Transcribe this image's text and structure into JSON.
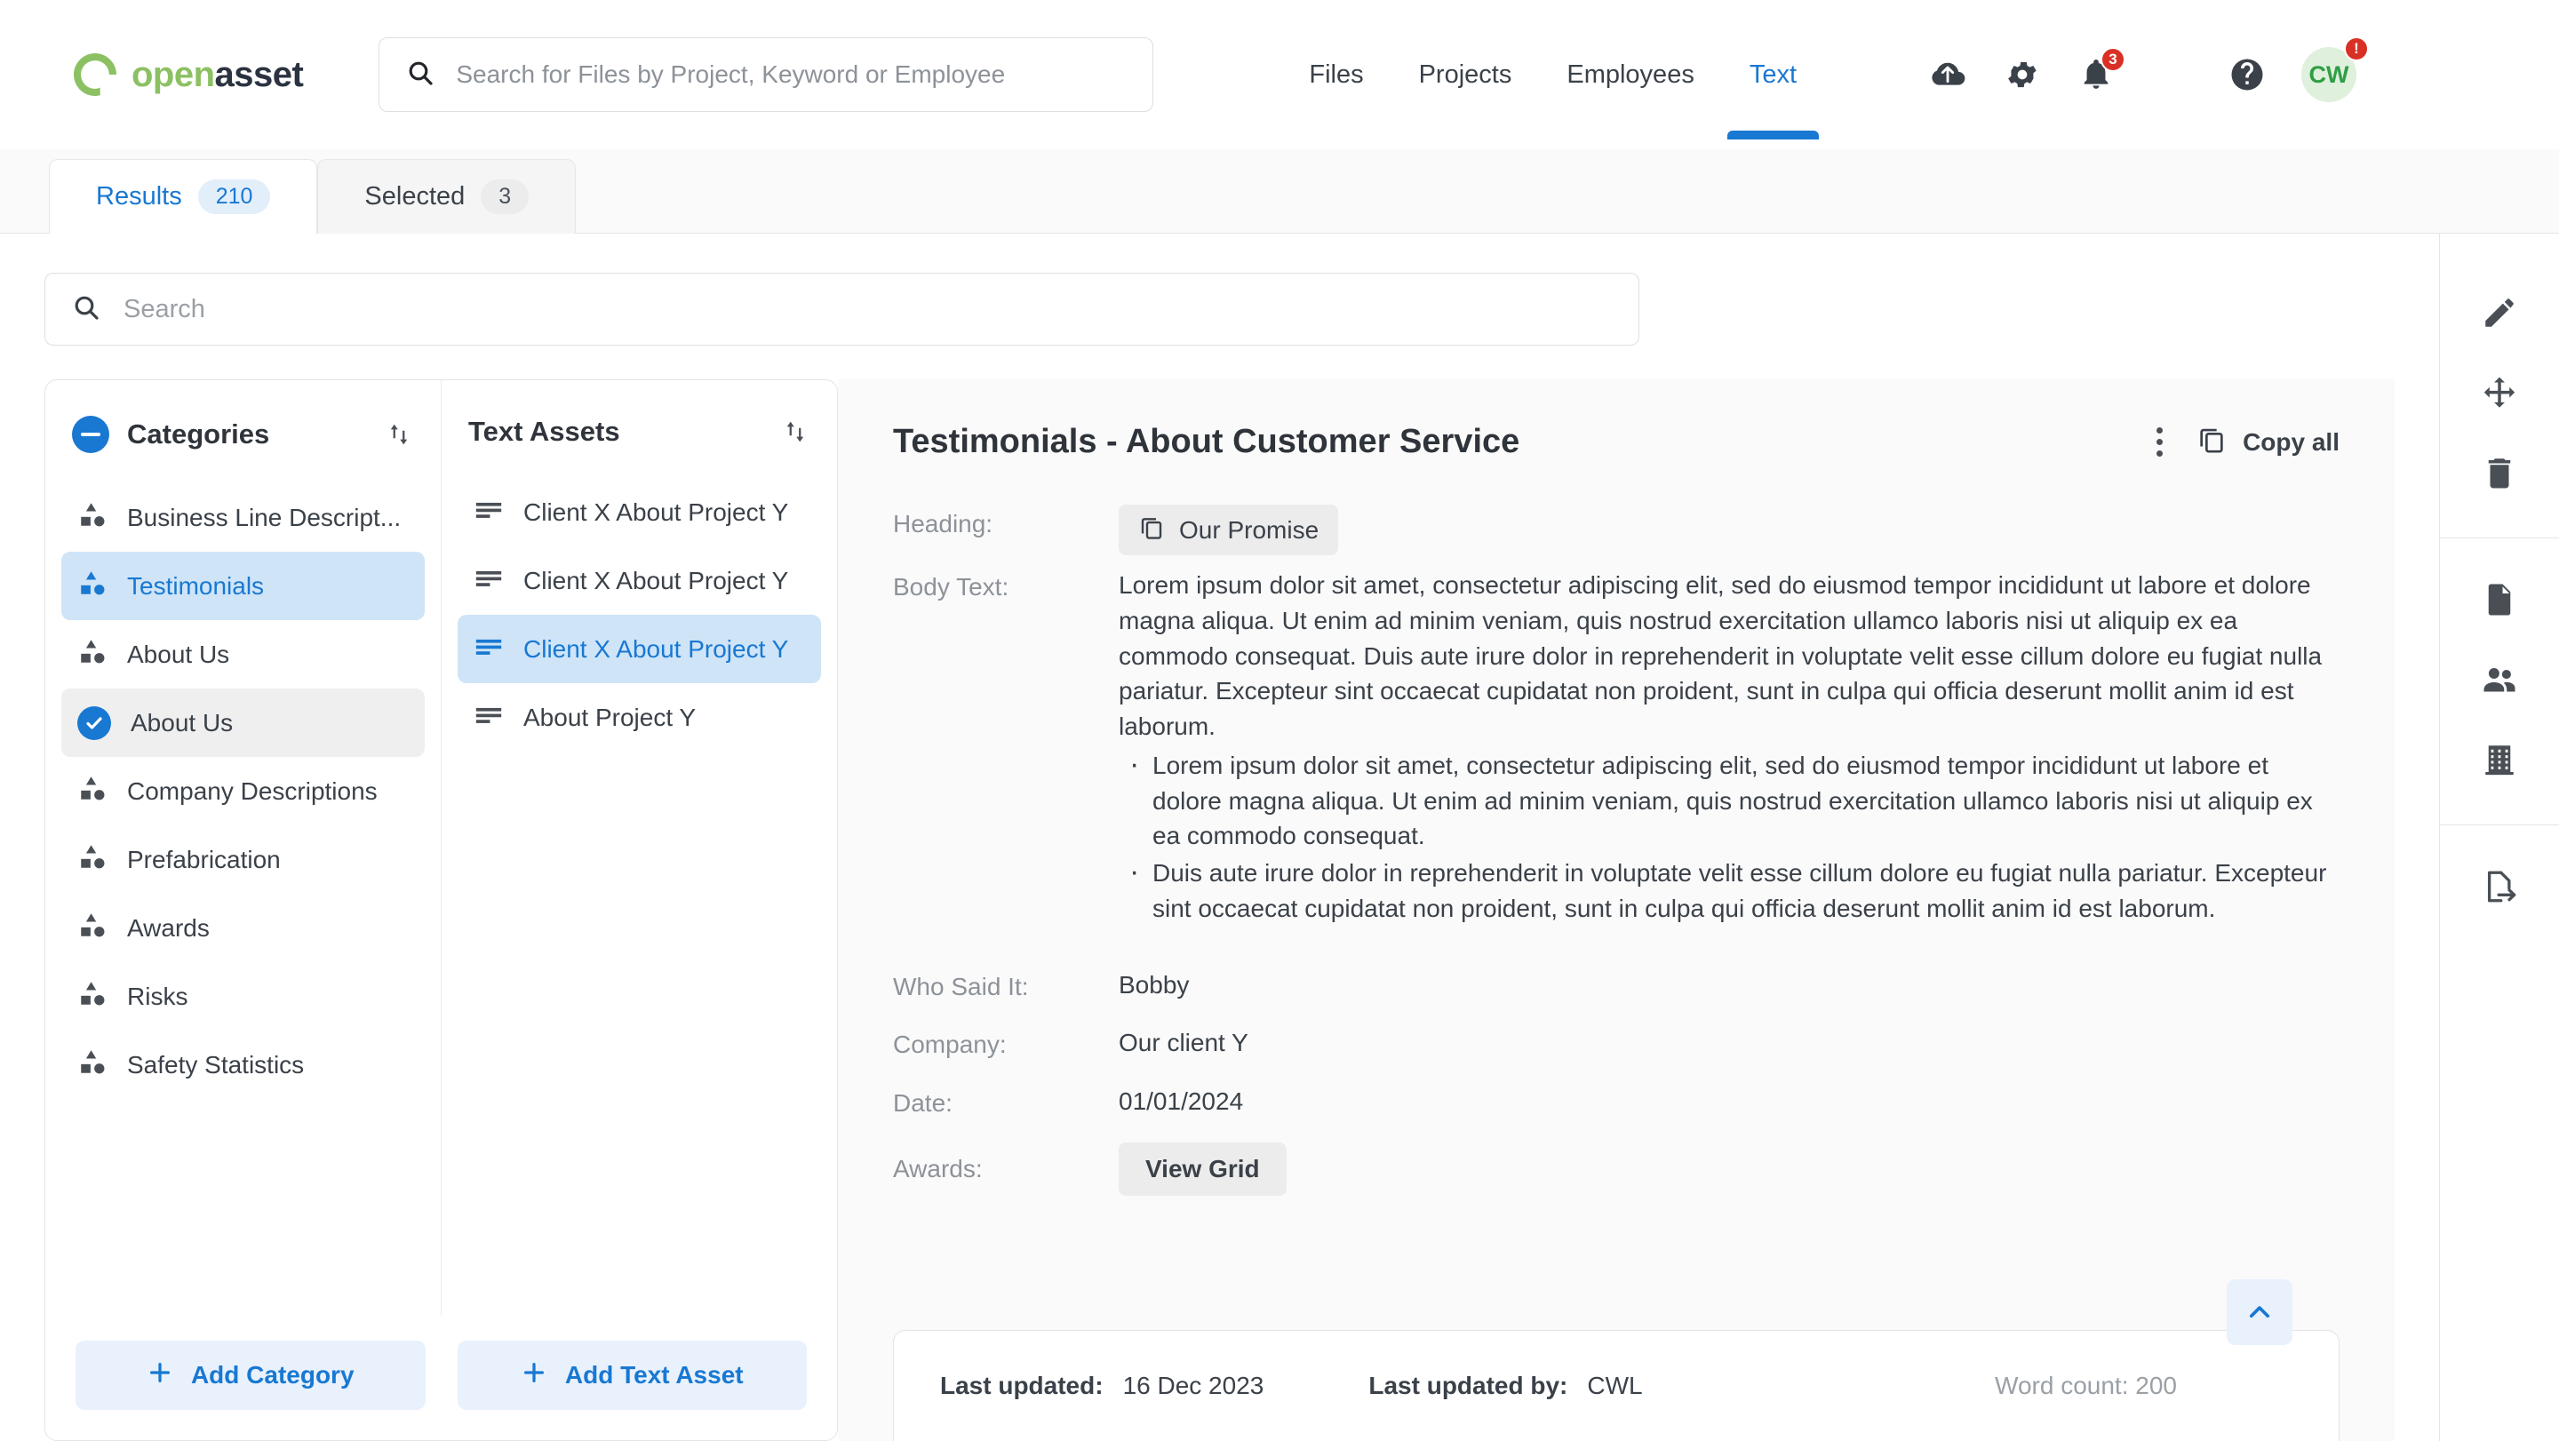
{
  "brand": {
    "name_part1": "open",
    "name_part2": "asset"
  },
  "global_search": {
    "placeholder": "Search for Files by Project, Keyword or Employee",
    "value": ""
  },
  "nav": {
    "items": [
      {
        "label": "Files",
        "active": false
      },
      {
        "label": "Projects",
        "active": false
      },
      {
        "label": "Employees",
        "active": false
      },
      {
        "label": "Text",
        "active": true
      }
    ]
  },
  "top_icons": {
    "upload": "upload-cloud-icon",
    "settings": "gear-icon",
    "notifications": "bell-icon",
    "notifications_badge": "3",
    "help": "help-circle-icon",
    "avatar_initials": "CW",
    "avatar_badge": "!"
  },
  "tabs": [
    {
      "label": "Results",
      "count": "210",
      "active": true
    },
    {
      "label": "Selected",
      "count": "3",
      "active": false
    }
  ],
  "local_search": {
    "placeholder": "Search",
    "value": ""
  },
  "categories_panel": {
    "title": "Categories",
    "sort_icon": "sort-arrows-icon",
    "collapse_icon": "minus-circle-icon",
    "items": [
      {
        "label": "Business Line Descript...",
        "state": "none"
      },
      {
        "label": "Testimonials",
        "state": "active"
      },
      {
        "label": "About Us",
        "state": "none"
      },
      {
        "label": "About Us",
        "state": "checked"
      },
      {
        "label": "Company Descriptions",
        "state": "none"
      },
      {
        "label": "Prefabrication",
        "state": "none"
      },
      {
        "label": "Awards",
        "state": "none"
      },
      {
        "label": "Risks",
        "state": "none"
      },
      {
        "label": "Safety Statistics",
        "state": "none"
      }
    ]
  },
  "assets_panel": {
    "title": "Text Assets",
    "sort_icon": "sort-arrows-icon",
    "items": [
      {
        "label": "Client X About Project Y",
        "state": "none"
      },
      {
        "label": "Client X About Project Y",
        "state": "none"
      },
      {
        "label": "Client X About Project Y",
        "state": "active"
      },
      {
        "label": "About Project Y",
        "state": "none"
      }
    ]
  },
  "add_buttons": {
    "add_category": "Add Category",
    "add_text_asset": "Add Text Asset"
  },
  "detail": {
    "title": "Testimonials - About Customer Service",
    "kebab_icon": "more-vertical-icon",
    "copy_all_label": "Copy all",
    "copy_all_icon": "copy-icon",
    "fields": {
      "heading_label": "Heading:",
      "heading_value": "Our Promise",
      "heading_copy_icon": "copy-icon",
      "body_label": "Body Text:",
      "body_paragraph": "Lorem ipsum dolor sit amet, consectetur adipiscing elit, sed do eiusmod tempor incididunt ut labore et dolore magna aliqua. Ut enim ad minim veniam, quis nostrud exercitation ullamco laboris nisi ut aliquip ex ea commodo consequat. Duis aute irure dolor in reprehenderit in voluptate velit esse cillum dolore eu fugiat nulla pariatur. Excepteur sint occaecat cupidatat non proident, sunt in culpa qui officia deserunt mollit anim id est laborum.",
      "body_bullets": [
        "Lorem ipsum dolor sit amet, consectetur adipiscing elit, sed do eiusmod tempor incididunt ut labore et dolore magna aliqua. Ut enim ad minim veniam, quis nostrud exercitation ullamco laboris nisi ut aliquip ex ea commodo consequat.",
        "Duis aute irure dolor in reprehenderit in voluptate velit esse cillum dolore eu fugiat nulla pariatur. Excepteur sint occaecat cupidatat non proident, sunt in culpa qui officia deserunt mollit anim id est laborum."
      ],
      "who_said_it_label": "Who Said It:",
      "who_said_it_value": "Bobby",
      "company_label": "Company:",
      "company_value": "Our client Y",
      "date_label": "Date:",
      "date_value": "01/01/2024",
      "awards_label": "Awards:",
      "awards_button": "View Grid"
    },
    "footer": {
      "last_updated_label": "Last updated:",
      "last_updated_value": "16 Dec 2023",
      "last_updated_by_label": "Last updated by:",
      "last_updated_by_value": "CWL",
      "word_count": "Word count: 200",
      "scroll_top_icon": "chevron-up-icon"
    }
  },
  "rail": {
    "items": [
      {
        "icon": "pencil-icon",
        "group": 1
      },
      {
        "icon": "move-icon",
        "group": 1
      },
      {
        "icon": "trash-icon",
        "group": 1
      },
      {
        "icon": "document-icon",
        "group": 2
      },
      {
        "icon": "people-icon",
        "group": 2
      },
      {
        "icon": "building-icon",
        "group": 2
      },
      {
        "icon": "export-document-icon",
        "group": 3
      }
    ]
  },
  "colors": {
    "accent": "#1878d2",
    "brand_green": "#8cc163",
    "brand_dark": "#2b3341",
    "danger": "#d93025",
    "selected_blue_bg": "#cfe4f7"
  }
}
